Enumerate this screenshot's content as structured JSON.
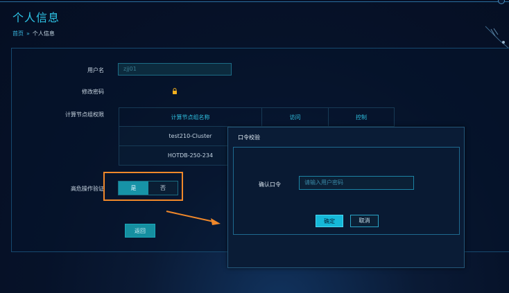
{
  "page": {
    "title": "个人信息"
  },
  "breadcrumb": {
    "home": "首页",
    "separator": "»",
    "current": "个人信息"
  },
  "form": {
    "username_label": "用户名",
    "username_value": "zjj01",
    "password_label": "修改密码",
    "password_icon": "lock-icon",
    "perm_label": "计算节点组权限",
    "high_risk_label": "高危操作验证",
    "toggle": {
      "yes": "是",
      "no": "否",
      "selected": "是"
    },
    "back_label": "返回"
  },
  "perm_table": {
    "headers": [
      "计算节点组名称",
      "访问",
      "控制"
    ],
    "rows": [
      [
        "test210-Cluster",
        "",
        ""
      ],
      [
        "HOTDB-250-234",
        "",
        ""
      ]
    ]
  },
  "dialog": {
    "title": "口令校验",
    "confirm_label": "确认口令",
    "input_placeholder": "请输入用户密码",
    "ok_label": "确定",
    "cancel_label": "取消"
  },
  "colors": {
    "accent": "#2ec6e8",
    "highlight": "#f0882a",
    "toggle_on": "#1793a7",
    "primary_button": "#15b8d8",
    "background": "#061229"
  }
}
